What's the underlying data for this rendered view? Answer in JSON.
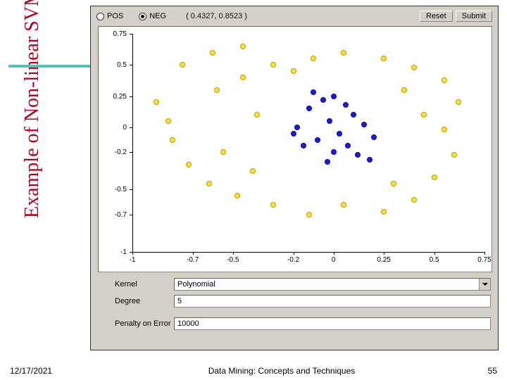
{
  "side_title": "Example of Non-linear SVM",
  "panel": {
    "radio_pos": "POS",
    "radio_neg": "NEG",
    "neg_selected": true,
    "coord_readout": "( 0.4327, 0.8523 )",
    "reset_label": "Reset",
    "submit_label": "Submit"
  },
  "form": {
    "kernel_label": "Kernel",
    "kernel_value": "Polynomial",
    "degree_label": "Degree",
    "degree_value": "5",
    "penalty_label": "Penalty on Error",
    "penalty_value": "10000"
  },
  "footer": {
    "date": "12/17/2021",
    "title": "Data Mining: Concepts and Techniques",
    "page": "55"
  },
  "chart_data": {
    "type": "scatter",
    "xlim": [
      -1.0,
      0.75
    ],
    "ylim": [
      -1.0,
      0.75
    ],
    "x_ticks": [
      -1.0,
      -0.7,
      -0.5,
      -0.2,
      0.0,
      0.25,
      0.5,
      0.75
    ],
    "y_ticks": [
      -1.0,
      -0.7,
      -0.5,
      -0.2,
      0.0,
      0.25,
      0.5,
      0.75
    ],
    "series": [
      {
        "name": "NEG",
        "color": "#1a1ae6",
        "points": [
          [
            0.0,
            0.25
          ],
          [
            -0.05,
            0.22
          ],
          [
            0.06,
            0.18
          ],
          [
            -0.12,
            0.15
          ],
          [
            0.1,
            0.1
          ],
          [
            -0.02,
            0.05
          ],
          [
            0.15,
            0.02
          ],
          [
            -0.18,
            0.0
          ],
          [
            0.03,
            -0.05
          ],
          [
            0.2,
            -0.08
          ],
          [
            -0.08,
            -0.1
          ],
          [
            0.07,
            -0.15
          ],
          [
            -0.15,
            -0.15
          ],
          [
            0.0,
            -0.2
          ],
          [
            0.12,
            -0.22
          ],
          [
            -0.03,
            -0.28
          ],
          [
            0.18,
            -0.26
          ],
          [
            -0.2,
            -0.05
          ],
          [
            -0.1,
            0.28
          ]
        ]
      },
      {
        "name": "POS",
        "color": "#ffe038",
        "points": [
          [
            -0.88,
            0.2
          ],
          [
            -0.75,
            0.5
          ],
          [
            -0.6,
            0.6
          ],
          [
            -0.45,
            0.65
          ],
          [
            -0.3,
            0.5
          ],
          [
            -0.1,
            0.55
          ],
          [
            0.05,
            0.6
          ],
          [
            0.25,
            0.55
          ],
          [
            0.4,
            0.48
          ],
          [
            0.55,
            0.38
          ],
          [
            0.62,
            0.2
          ],
          [
            0.55,
            -0.02
          ],
          [
            0.6,
            -0.22
          ],
          [
            0.5,
            -0.4
          ],
          [
            0.4,
            -0.58
          ],
          [
            0.25,
            -0.68
          ],
          [
            0.05,
            -0.62
          ],
          [
            -0.12,
            -0.7
          ],
          [
            -0.3,
            -0.62
          ],
          [
            -0.48,
            -0.55
          ],
          [
            -0.62,
            -0.45
          ],
          [
            -0.72,
            -0.3
          ],
          [
            -0.8,
            -0.1
          ],
          [
            -0.82,
            0.05
          ],
          [
            -0.58,
            0.3
          ],
          [
            -0.45,
            0.4
          ],
          [
            -0.38,
            0.1
          ],
          [
            0.35,
            0.3
          ],
          [
            0.45,
            0.1
          ],
          [
            -0.55,
            -0.2
          ],
          [
            -0.4,
            -0.35
          ],
          [
            0.3,
            -0.45
          ],
          [
            -0.2,
            0.45
          ]
        ]
      }
    ]
  }
}
